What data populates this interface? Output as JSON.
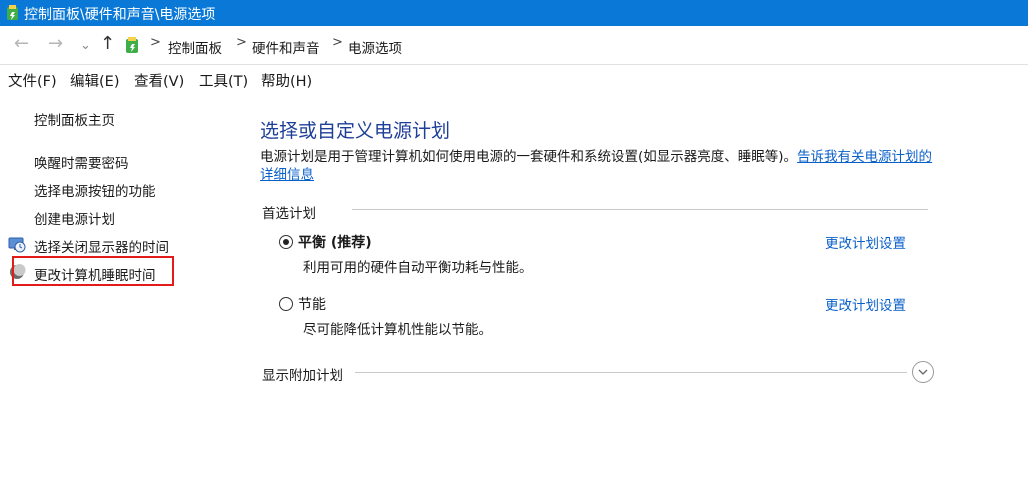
{
  "window": {
    "title": "控制面板\\硬件和声音\\电源选项"
  },
  "nav": {
    "back": "←",
    "forward": "→",
    "recent": "⌄",
    "up": "↑",
    "breadcrumb": [
      "控制面板",
      "硬件和声音",
      "电源选项"
    ],
    "separator": ">"
  },
  "menu": [
    "文件(F)",
    "编辑(E)",
    "查看(V)",
    "工具(T)",
    "帮助(H)"
  ],
  "sidebar": {
    "home": "控制面板主页",
    "items": [
      {
        "label": "唤醒时需要密码",
        "icon": ""
      },
      {
        "label": "选择电源按钮的功能",
        "icon": ""
      },
      {
        "label": "创建电源计划",
        "icon": ""
      },
      {
        "label": "选择关闭显示器的时间",
        "icon": "monitor-clock-icon"
      },
      {
        "label": "更改计算机睡眠时间",
        "icon": "moon-icon",
        "highlighted": true
      }
    ],
    "highlight_color": "#e31b1b"
  },
  "main": {
    "title": "选择或自定义电源计划",
    "description": "电源计划是用于管理计算机如何使用电源的一套硬件和系统设置(如显示器亮度、睡眠等)。",
    "description_link": "告诉我有关电源计划的详细信息",
    "preferred_section": "首选计划",
    "plans": [
      {
        "name": "平衡 (推荐)",
        "desc": "利用可用的硬件自动平衡功耗与性能。",
        "link": "更改计划设置",
        "selected": true
      },
      {
        "name": "节能",
        "desc": "尽可能降低计算机性能以节能。",
        "link": "更改计划设置",
        "selected": false
      }
    ],
    "additional_section": "显示附加计划"
  },
  "colors": {
    "titlebar": "#0a78d6",
    "heading": "#1e3f99",
    "link": "#0a60c9"
  }
}
